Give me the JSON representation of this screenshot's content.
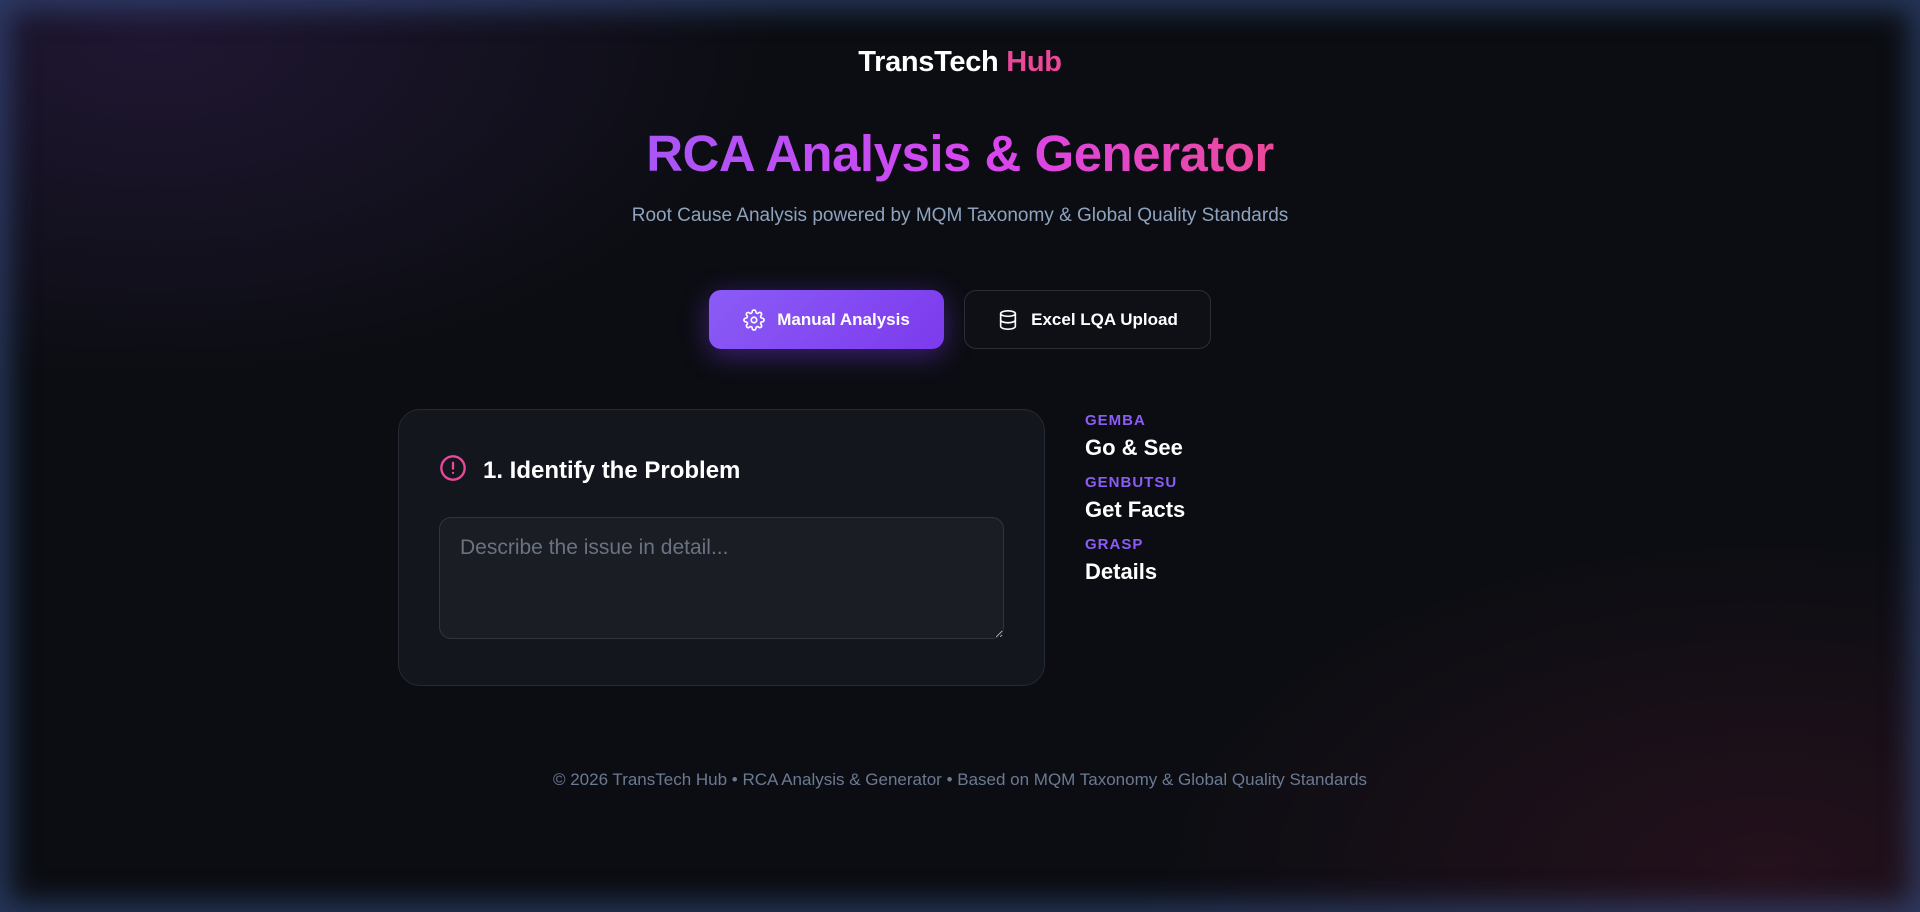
{
  "header": {
    "brand_name": "TransTech",
    "brand_accent": "Hub",
    "title": "RCA Analysis & Generator",
    "subtitle": "Root Cause Analysis powered by MQM Taxonomy & Global Quality Standards"
  },
  "mode_buttons": {
    "manual": {
      "label": "Manual Analysis",
      "icon": "gear-icon",
      "active": true
    },
    "excel": {
      "label": "Excel LQA Upload",
      "icon": "database-icon",
      "active": false
    }
  },
  "problem_card": {
    "icon": "alert-circle-icon",
    "title": "1. Identify the Problem",
    "input_value": "",
    "input_placeholder": "Describe the issue in detail..."
  },
  "principles": [
    {
      "label": "GEMBA",
      "value": "Go & See"
    },
    {
      "label": "GENBUTSU",
      "value": "Get Facts"
    },
    {
      "label": "GRASP",
      "value": "Details"
    }
  ],
  "footer": {
    "text": "© 2026 TransTech Hub • RCA Analysis & Generator • Based on MQM Taxonomy & Global Quality Standards"
  },
  "colors": {
    "background": "#0b0d12",
    "accent_purple": "#8b5cf6",
    "accent_pink": "#ec4899",
    "subtitle": "#8fa3bf",
    "footer": "#6b7a93"
  }
}
